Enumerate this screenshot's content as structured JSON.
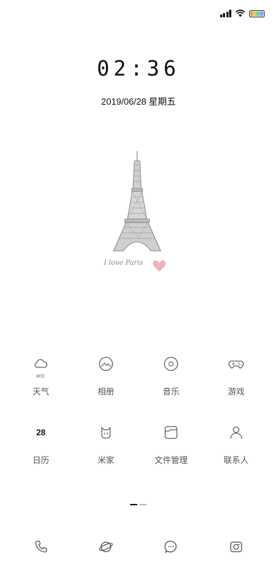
{
  "lockscreen": {
    "time": "02:36",
    "date": "2019/06/28 星期五",
    "wallpaper_caption": "I love Paris"
  },
  "status_bar": {
    "signal": "full",
    "wifi": "connected",
    "battery": "charged"
  },
  "apps": [
    {
      "label": "天气",
      "icon": "weather-icon",
      "sub": "MTC"
    },
    {
      "label": "相册",
      "icon": "gallery-icon"
    },
    {
      "label": "音乐",
      "icon": "music-icon"
    },
    {
      "label": "游戏",
      "icon": "gamepad-icon"
    },
    {
      "label": "日历",
      "icon": "calendar-icon",
      "day": "28"
    },
    {
      "label": "米家",
      "icon": "mijia-icon"
    },
    {
      "label": "文件管理",
      "icon": "folder-icon"
    },
    {
      "label": "联系人",
      "icon": "contacts-icon"
    }
  ],
  "dock": [
    {
      "icon": "phone-icon"
    },
    {
      "icon": "browser-icon"
    },
    {
      "icon": "messages-icon"
    },
    {
      "icon": "camera-icon"
    }
  ],
  "pager": {
    "pages": 2,
    "current": 1
  }
}
